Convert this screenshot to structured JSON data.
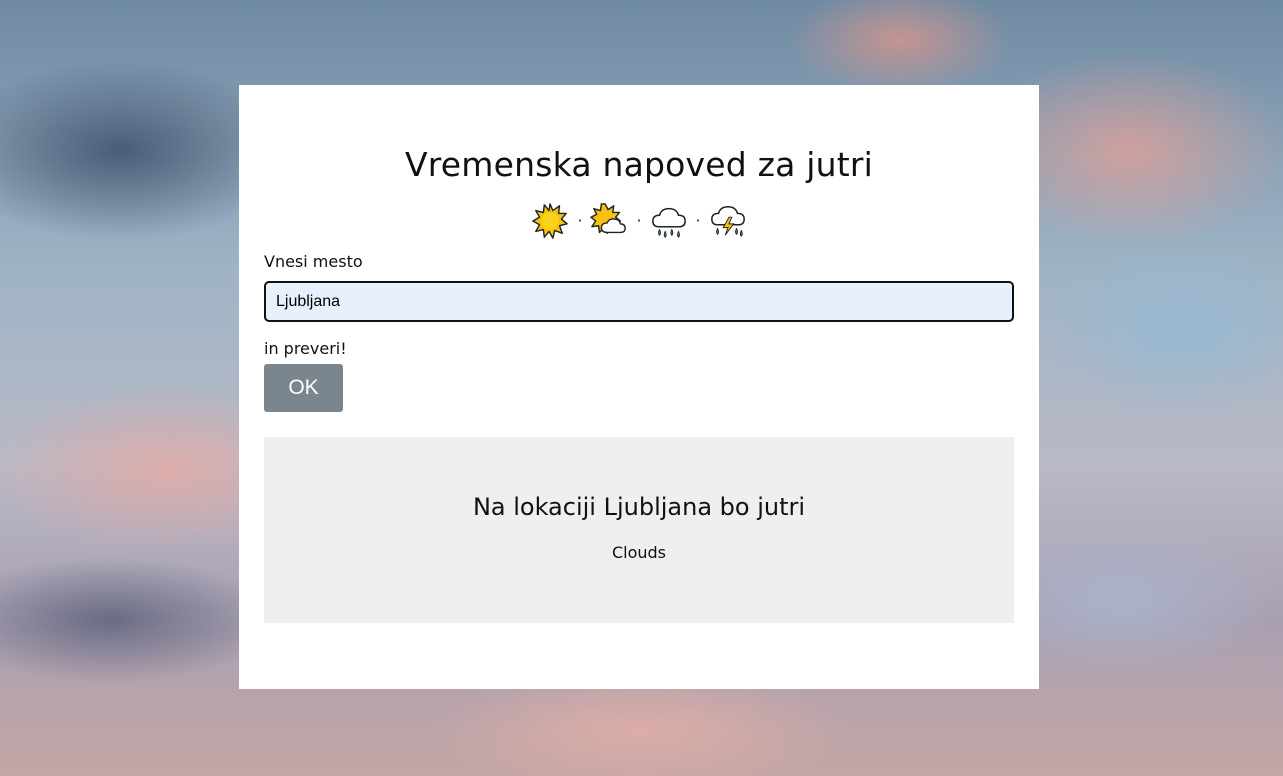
{
  "header": {
    "title": "Vremenska napoved za jutri"
  },
  "icons": [
    "sun-icon",
    "sun-behind-cloud-icon",
    "rain-cloud-icon",
    "thunder-rain-cloud-icon"
  ],
  "separator": "·",
  "form": {
    "city_label": "Vnesi mesto",
    "city_value": "Ljubljana",
    "check_label": "in preveri!",
    "ok_label": "OK"
  },
  "result": {
    "heading": "Na lokaciji Ljubljana bo jutri",
    "condition": "Clouds"
  },
  "colors": {
    "button": "#7a858d",
    "input_bg": "#e8effd",
    "result_bg": "#efefef",
    "card": "#ffffff"
  }
}
